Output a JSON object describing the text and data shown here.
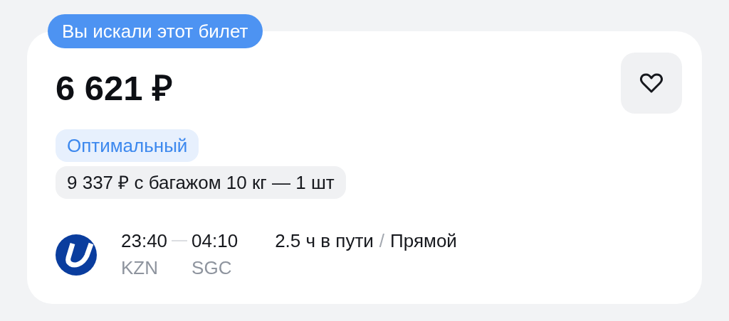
{
  "badge": "Вы искали этот билет",
  "price": "6 621 ₽",
  "favorite": false,
  "tag": "Оптимальный",
  "baggage": "9 337 ₽ с багажом 10 кг — 1 шт",
  "flight": {
    "departure_time": "23:40",
    "arrival_time": "04:10",
    "departure_code": "KZN",
    "arrival_code": "SGC",
    "duration": "2.5 ч в пути",
    "separator": "/",
    "transfers": "Прямой"
  }
}
